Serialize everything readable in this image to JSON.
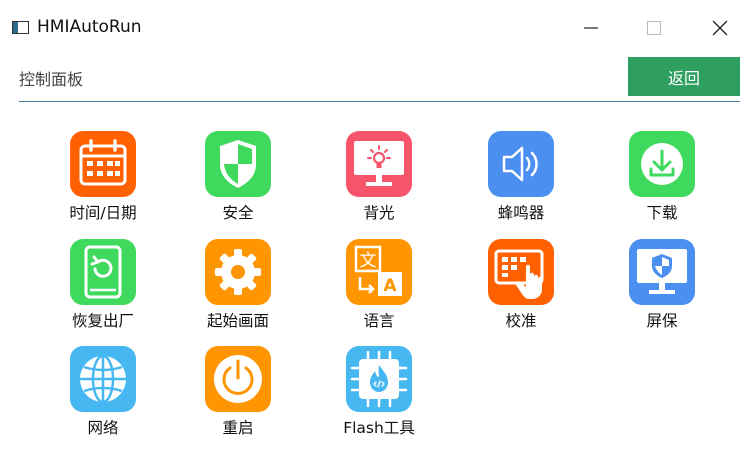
{
  "window": {
    "title": "HMIAutoRun"
  },
  "header": {
    "label": "控制面板",
    "back_label": "返回"
  },
  "tiles": [
    {
      "label": "时间/日期",
      "icon": "calendar-icon",
      "color": "#ff6100"
    },
    {
      "label": "安全",
      "icon": "shield-icon",
      "color": "#3fd95e"
    },
    {
      "label": "背光",
      "icon": "backlight-monitor-icon",
      "color": "#f5546b"
    },
    {
      "label": "蜂鸣器",
      "icon": "speaker-icon",
      "color": "#4b8ff0"
    },
    {
      "label": "下载",
      "icon": "download-icon",
      "color": "#3fd95e"
    },
    {
      "label": "恢复出厂",
      "icon": "factory-reset-icon",
      "color": "#3fd95e"
    },
    {
      "label": "起始画面",
      "icon": "gear-icon",
      "color": "#ff9500"
    },
    {
      "label": "语言",
      "icon": "translate-icon",
      "color": "#ff9500"
    },
    {
      "label": "校准",
      "icon": "touch-calibration-icon",
      "color": "#ff6100"
    },
    {
      "label": "屏保",
      "icon": "screen-lock-icon",
      "color": "#4b8ff0"
    },
    {
      "label": "网络",
      "icon": "globe-icon",
      "color": "#47b7f2"
    },
    {
      "label": "重启",
      "icon": "power-icon",
      "color": "#ff9500"
    },
    {
      "label": "Flash工具",
      "icon": "flash-chip-icon",
      "color": "#47b7f2"
    }
  ]
}
